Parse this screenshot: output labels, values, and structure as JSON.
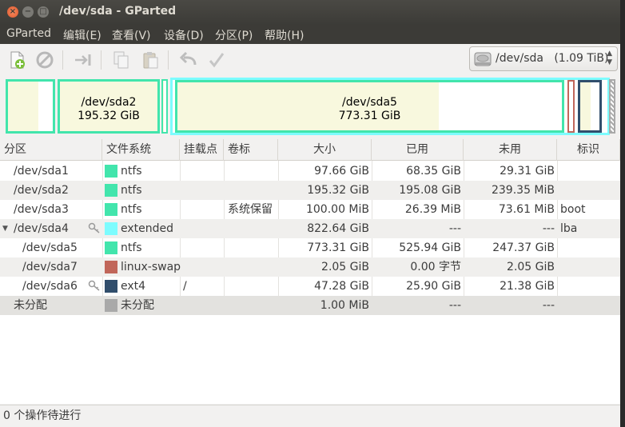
{
  "window": {
    "title": "/dev/sda - GParted"
  },
  "menu": [
    "GParted",
    "编辑(E)",
    "查看(V)",
    "设备(D)",
    "分区(P)",
    "帮助(H)"
  ],
  "device": {
    "label": "/dev/sda   (1.09 TiB)"
  },
  "diskbar": {
    "sda2": {
      "name": "/dev/sda2",
      "size": "195.32 GiB"
    },
    "sda5": {
      "name": "/dev/sda5",
      "size": "773.31 GiB"
    }
  },
  "table": {
    "headers": [
      "分区",
      "文件系统",
      "挂载点",
      "卷标",
      "大小",
      "已用",
      "未用",
      "标识"
    ],
    "rows": [
      {
        "partition": "/dev/sda1",
        "fs": "ntfs",
        "fs_color": "#42e5ac",
        "mount": "",
        "label": "",
        "size": "97.66 GiB",
        "used": "68.35 GiB",
        "unused": "29.31 GiB",
        "flags": ""
      },
      {
        "partition": "/dev/sda2",
        "fs": "ntfs",
        "fs_color": "#42e5ac",
        "mount": "",
        "label": "",
        "size": "195.32 GiB",
        "used": "195.08 GiB",
        "unused": "239.35 MiB",
        "flags": ""
      },
      {
        "partition": "/dev/sda3",
        "fs": "ntfs",
        "fs_color": "#42e5ac",
        "mount": "",
        "label": "系统保留",
        "size": "100.00 MiB",
        "used": "26.39 MiB",
        "unused": "73.61 MiB",
        "flags": "boot"
      },
      {
        "partition": "/dev/sda4",
        "fs": "extended",
        "fs_color": "#7dfcfe",
        "mount": "",
        "label": "",
        "size": "822.64 GiB",
        "used": "---",
        "unused": "---",
        "flags": "lba"
      },
      {
        "partition": "/dev/sda5",
        "fs": "ntfs",
        "fs_color": "#42e5ac",
        "mount": "",
        "label": "",
        "size": "773.31 GiB",
        "used": "525.94 GiB",
        "unused": "247.37 GiB",
        "flags": ""
      },
      {
        "partition": "/dev/sda7",
        "fs": "linux-swap",
        "fs_color": "#c1665a",
        "mount": "",
        "label": "",
        "size": "2.05 GiB",
        "used": "0.00 字节",
        "unused": "2.05 GiB",
        "flags": ""
      },
      {
        "partition": "/dev/sda6",
        "fs": "ext4",
        "fs_color": "#314e6c",
        "mount": "/",
        "label": "",
        "size": "47.28 GiB",
        "used": "25.90 GiB",
        "unused": "21.38 GiB",
        "flags": ""
      },
      {
        "partition": "未分配",
        "fs": "未分配",
        "fs_color": "#a9a9a9",
        "mount": "",
        "label": "",
        "size": "1.00 MiB",
        "used": "---",
        "unused": "---",
        "flags": ""
      }
    ]
  },
  "status": {
    "text": "0 个操作待进行"
  }
}
